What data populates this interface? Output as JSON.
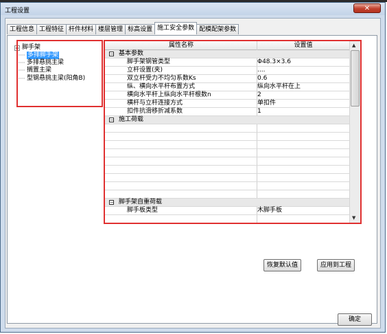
{
  "window": {
    "title": "工程设置",
    "close": "✕"
  },
  "tabs": [
    "工程信息",
    "工程特征",
    "杆件材料",
    "楼层管理",
    "标高设置",
    "施工安全参数",
    "配模配架参数"
  ],
  "tree": {
    "root": "脚手架",
    "children": [
      "多排脚手架",
      "多排悬挑主梁",
      "搁置主梁",
      "型钢悬挑主梁(阳角B)"
    ],
    "selected_index": 0
  },
  "grid": {
    "col_name": "属性名称",
    "col_value": "设置值",
    "rows": [
      {
        "type": "group",
        "label": "基本参数",
        "expander": "−"
      },
      {
        "type": "item",
        "name": "脚手架钢管类型",
        "value": "Φ48.3×3.6"
      },
      {
        "type": "item",
        "name": "立杆设置(夹)",
        "value": "...."
      },
      {
        "type": "item",
        "name": "双立杆受力不均匀系数Ks",
        "value": "0.6"
      },
      {
        "type": "item",
        "name": "纵、横向水平杆布置方式",
        "value": "纵向水平杆在上"
      },
      {
        "type": "item",
        "name": "横向水平杆上纵向水平杆根数n",
        "value": "2"
      },
      {
        "type": "item",
        "name": "横杆与立杆连接方式",
        "value": "单扣件"
      },
      {
        "type": "item",
        "name": "扣件抗滑移折减系数",
        "value": "1"
      },
      {
        "type": "group",
        "label": "施工荷载",
        "expander": "−"
      },
      {
        "type": "item",
        "name": "",
        "value": ""
      },
      {
        "type": "item",
        "name": "",
        "value": ""
      },
      {
        "type": "item",
        "name": "",
        "value": ""
      },
      {
        "type": "item",
        "name": "",
        "value": ""
      },
      {
        "type": "item",
        "name": "",
        "value": ""
      },
      {
        "type": "item",
        "name": "",
        "value": ""
      },
      {
        "type": "item",
        "name": "",
        "value": ""
      },
      {
        "type": "item",
        "name": "",
        "value": ""
      },
      {
        "type": "item",
        "name": "",
        "value": ""
      },
      {
        "type": "group",
        "label": "脚手架自重荷载",
        "expander": "−"
      },
      {
        "type": "item",
        "name": "脚手板类型",
        "value": "木脚手板"
      }
    ]
  },
  "buttons": {
    "restore_default": "恢复默认值",
    "apply_project": "应用到工程",
    "ok": "确定"
  },
  "colors": {
    "highlight": "#e03030",
    "selection": "#3399ff"
  }
}
